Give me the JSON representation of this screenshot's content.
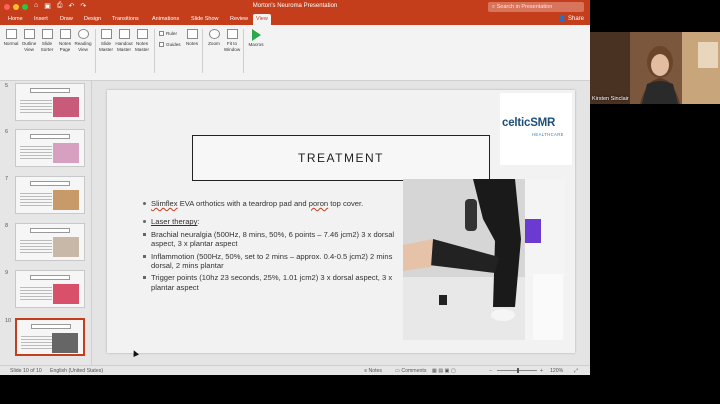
{
  "window": {
    "title": "Morton's Neuroma Presentation",
    "search_placeholder": "Search in Presentation",
    "share_label": "Share"
  },
  "tabs": [
    "Home",
    "Insert",
    "Draw",
    "Design",
    "Transitions",
    "Animations",
    "Slide Show",
    "Review",
    "View"
  ],
  "active_tab": "View",
  "ribbon": {
    "normal": "Normal",
    "outline_view": "Outline View",
    "slide_sorter": "Slide Sorter",
    "notes_page": "Notes Page",
    "reading_view": "Reading View",
    "slide_master": "Slide Master",
    "handout_master": "Handout Master",
    "notes_master": "Notes Master",
    "ruler": "Ruler",
    "guides": "Guides",
    "notes": "Notes",
    "zoom": "Zoom",
    "fit_to_window": "Fit to Window",
    "macros": "Macros"
  },
  "thumbnails": [
    {
      "num": "5",
      "color": "#c85a7a"
    },
    {
      "num": "6",
      "color": "#d8a0c0"
    },
    {
      "num": "7",
      "color": "#c89a6a"
    },
    {
      "num": "8",
      "color": "#c8b8a8"
    },
    {
      "num": "9",
      "color": "#d8506a"
    },
    {
      "num": "10",
      "color": "#666666"
    }
  ],
  "slide": {
    "logo_main": "celticSMR",
    "logo_sub": "HEALTHCARE",
    "title": "TREATMENT",
    "bullet1_a": "Slimflex",
    "bullet1_b": " EVA orthotics with a teardrop pad and ",
    "bullet1_c": "poron",
    "bullet1_d": " top cover.",
    "laser_heading": "Laser therapy",
    "laser_colon": ":",
    "sub1": "Brachial neuralgia (500Hz, 8 mins, 50%, 6 points – 7.46 jcm2) 3 x dorsal aspect, 3 x plantar aspect",
    "sub2": "Inflammotion (500Hz, 50%, set to 2 mins – approx. 0.4-0.5 jcm2) 2 mins dorsal, 2 mins plantar",
    "sub3": "Trigger points (10hz 23 seconds, 25%, 1.01 jcm2)  3 x dorsal aspect, 3 x plantar aspect"
  },
  "status": {
    "slide_of": "Slide 10 of 10",
    "language": "English (United States)",
    "notes": "Notes",
    "comments": "Comments",
    "zoom": "120%"
  },
  "webcam": {
    "name": "Kirsten Sinclair"
  }
}
